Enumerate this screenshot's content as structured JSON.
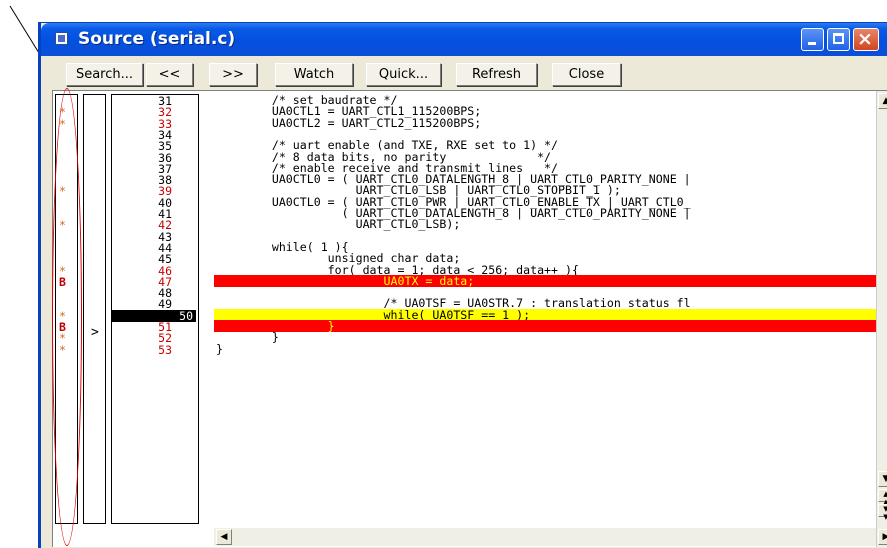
{
  "window": {
    "title": "Source (serial.c)"
  },
  "toolbar": {
    "search": "Search...",
    "back": "<<",
    "forward": ">>",
    "watch": "Watch",
    "quick": "Quick...",
    "refresh": "Refresh",
    "close": "Close"
  },
  "gutter": {
    "pc_arrow": ">"
  },
  "lines": [
    {
      "num": "31",
      "mark": "",
      "code": "        /* set baudrate */"
    },
    {
      "num": "32",
      "mark": "*",
      "code": "        UA0CTL1 = UART_CTL1_115200BPS;"
    },
    {
      "num": "33",
      "mark": "*",
      "code": "        UA0CTL2 = UART_CTL2_115200BPS;"
    },
    {
      "num": "34",
      "mark": "",
      "code": ""
    },
    {
      "num": "35",
      "mark": "",
      "code": "        /* uart enable (and TXE, RXE set to 1) */"
    },
    {
      "num": "36",
      "mark": "",
      "code": "        /* 8 data bits, no parity             */"
    },
    {
      "num": "37",
      "mark": "",
      "code": "        /* enable receive and transmit lines   */"
    },
    {
      "num": "38",
      "mark": "",
      "code": "        UA0CTL0 = ( UART_CTL0_DATALENGTH_8 | UART_CTL0_PARITY_NONE |"
    },
    {
      "num": "39",
      "mark": "*",
      "code": "                    UART_CTL0_LSB | UART_CTL0_STOPBIT_1 );"
    },
    {
      "num": "40",
      "mark": "",
      "code": "        UA0CTL0 = ( UART_CTL0_PWR | UART_CTL0_ENABLE_TX | UART_CTL0_"
    },
    {
      "num": "41",
      "mark": "",
      "code": "                  ( UART_CTL0_DATALENGTH_8 | UART_CTL0_PARITY_NONE |"
    },
    {
      "num": "42",
      "mark": "*",
      "code": "                    UART_CTL0_LSB);"
    },
    {
      "num": "43",
      "mark": "",
      "code": ""
    },
    {
      "num": "44",
      "mark": "",
      "code": "        while( 1 ){"
    },
    {
      "num": "45",
      "mark": "",
      "code": "                unsigned char data;"
    },
    {
      "num": "46",
      "mark": "*",
      "code": "                for( data = 1; data < 256; data++ ){"
    },
    {
      "num": "47",
      "mark": "B",
      "code": "                        UA0TX = data;"
    },
    {
      "num": "48",
      "mark": "",
      "code": ""
    },
    {
      "num": "49",
      "mark": "",
      "code": "                        /* UA0TSF = UA0STR.7 : translation status fl"
    },
    {
      "num": "50",
      "mark": "*",
      "code": "                        while( UA0TSF == 1 );"
    },
    {
      "num": "51",
      "mark": "B",
      "code": "                }"
    },
    {
      "num": "52",
      "mark": "*",
      "code": "        }"
    },
    {
      "num": "53",
      "mark": "*",
      "code": "}"
    }
  ],
  "colors": {
    "breakpoint": "#ff0000",
    "current": "#ffff00",
    "annotation": "#e00000"
  }
}
